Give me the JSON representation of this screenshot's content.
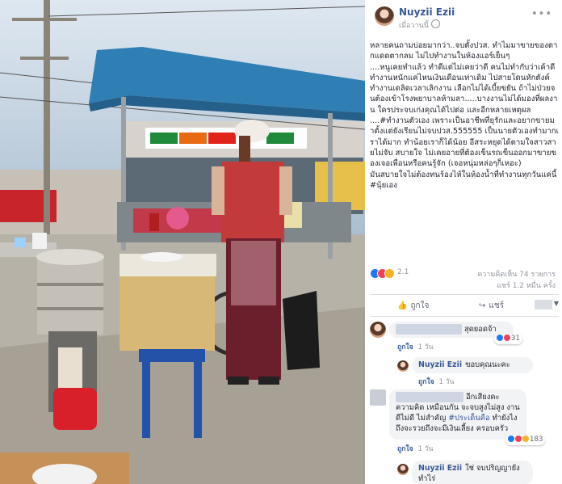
{
  "post": {
    "author": "Nuyzii Ezii",
    "time": "เมื่อวานนี้",
    "paragraphs": [
      "หลายคนถามบ่อยมากว่า..จบตั้งปวส. ทำไมมาขายของตากแดดตากลม ไม่ไปทำงานในห้องแอร์เย็นๆ",
      "....หนูเคยทำแล้ว ทำดีแต่ไม่เคยว่าดี คนไม่ทำกับว่าเค้าดี ทำงานหนักแค่ไหนเงินเดือนเท่าเดิม ไปสายโดนหักตังค์",
      "ทำงานเดลิดเวลาเลิกงาน เลือกไม่ได้เบี้ยขยัน ถ้าไม่ป่วยจนต้องเข้าโรงพยาบาลห้ามลา.....บางงานไม่ได้มองที่ผลงาน ใครประจบเก่งคุณได้ไปต่อ และอีกหลายเหตุผล",
      "....#ทำงานตัวเอง เพราะเป็นอาชีพที่ยุรักและอยากขายมาตั้งแต่ยังเรียนไม่จบปวส.555555 เป็นนายตัวเองทำมากเราได้มาก ทำน้อยเราก็ได้น้อย อีสระหยุดได้ตามใจสาวสายไม่จับ สบายใจ ไม่เคยอายที่ต้องเข็นรถเข็นออกมาขายของเจอเพื่อนหรือคนรู้จัก (เจอหนุ่มหล่อๆก็เหอะ)",
      "มันสบายใจไม่ต้องทนร้องไห้ในห้องน้ำที่ทำงานทุกวันแค่นี้ #นุ้ยเอง"
    ],
    "hashtag_1": "#ทำงานตัวเอง",
    "hashtag_2": "#นุ้ยเอง"
  },
  "stats": {
    "reaction_count": "2.1",
    "comments": "ความคิดเห็น 74 รายการ",
    "shares": "แชร์ 1.2 หมื่น ครั้ง"
  },
  "actions": {
    "like": "ถูกใจ",
    "share": "แชร์"
  },
  "comments": [
    {
      "text": "สุดยอดจ้า",
      "like": "ถูกใจ",
      "time": "1 วัน",
      "reactions": "31"
    },
    {
      "name": "Nuyzii Ezii",
      "text": "ขอบคุณนะคะ",
      "like": "ถูกใจ",
      "time": "1 วัน"
    },
    {
      "text_line1": "อีกเสียงคะ ความคิด",
      "text_rest": "เหมือนกัน จะจบสูงไม่สูง งานดีไม่ดี ไม่สำคัญ",
      "hashtag": "#ประเด็นคือ",
      "text_tail": "ทำยังไงถึงจะรวยถึงจะมีเงินเลี้ยง ครอบครัว",
      "like": "ถูกใจ",
      "time": "1 วัน",
      "reactions": "183"
    },
    {
      "name": "Nuyzii Ezii",
      "text": "ใช่ จบปริญญายังทำไร่"
    }
  ],
  "icons": {
    "like_color": "#2078f4",
    "love_color": "#f33e58",
    "wow_color": "#f7b125",
    "link_color": "#365899"
  }
}
